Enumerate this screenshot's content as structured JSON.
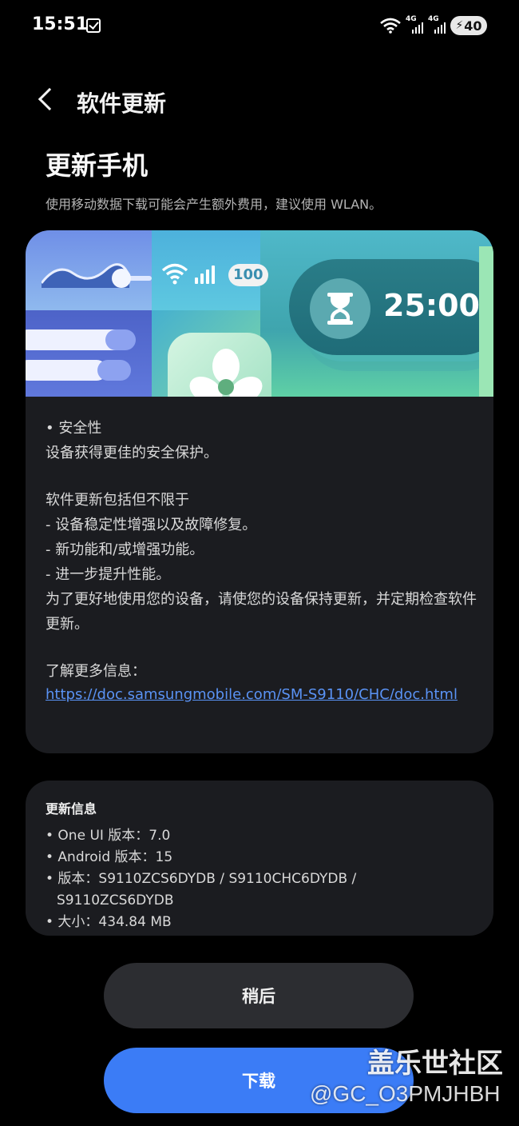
{
  "status_bar": {
    "time": "15:51",
    "network_tags": [
      "4G",
      "4G"
    ],
    "battery": "40"
  },
  "header": {
    "title": "软件更新"
  },
  "page": {
    "title": "更新手机",
    "notice": "使用移动数据下载可能会产生额外费用，建议使用 WLAN。"
  },
  "banner": {
    "battery_text": "100",
    "timer": "25:00"
  },
  "release_notes": {
    "security_heading": "• 安全性",
    "security_desc": "设备获得更佳的安全保护。",
    "includes_heading": "软件更新包括但不限于",
    "items": [
      "- 设备稳定性增强以及故障修复。",
      "- 新功能和/或增强功能。",
      "- 进一步提升性能。"
    ],
    "advice": "为了更好地使用您的设备，请使您的设备保持更新，并定期检查软件更新。",
    "more_info_label": "了解更多信息：",
    "more_info_link": "https://doc.samsungmobile.com/SM-S9110/CHC/doc.html"
  },
  "update_info": {
    "title": "更新信息",
    "one_ui": "• One UI 版本：7.0",
    "android": "• Android 版本：15",
    "version_line1": "• 版本：S9110ZCS6DYDB / S9110CHC6DYDB /",
    "version_line2": "S9110ZCS6DYDB",
    "size": "• 大小：434.84 MB"
  },
  "buttons": {
    "later": "稍后",
    "download": "下载"
  },
  "watermark": {
    "site": "盖乐世社区",
    "user": "@GC_O3PMJHBH"
  },
  "colors": {
    "background": "#000000",
    "card": "#1b1c20",
    "accent": "#3b7cf6",
    "link": "#5a93f5"
  }
}
